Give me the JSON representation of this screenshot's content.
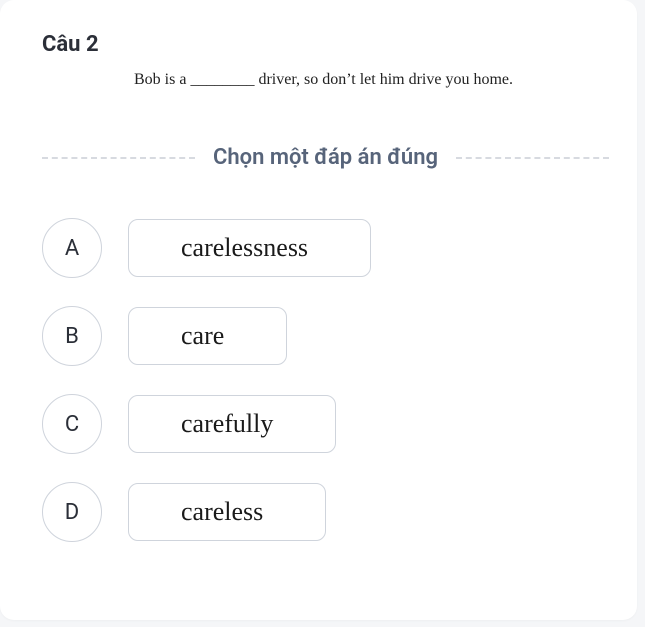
{
  "question": {
    "title": "Câu 2",
    "prompt": "Bob is a ________ driver, so don’t let him drive you home."
  },
  "instruction": "Chọn một đáp án đúng",
  "options": [
    {
      "letter": "A",
      "text": "carelessness"
    },
    {
      "letter": "B",
      "text": "care"
    },
    {
      "letter": "C",
      "text": "carefully"
    },
    {
      "letter": "D",
      "text": "careless"
    }
  ]
}
